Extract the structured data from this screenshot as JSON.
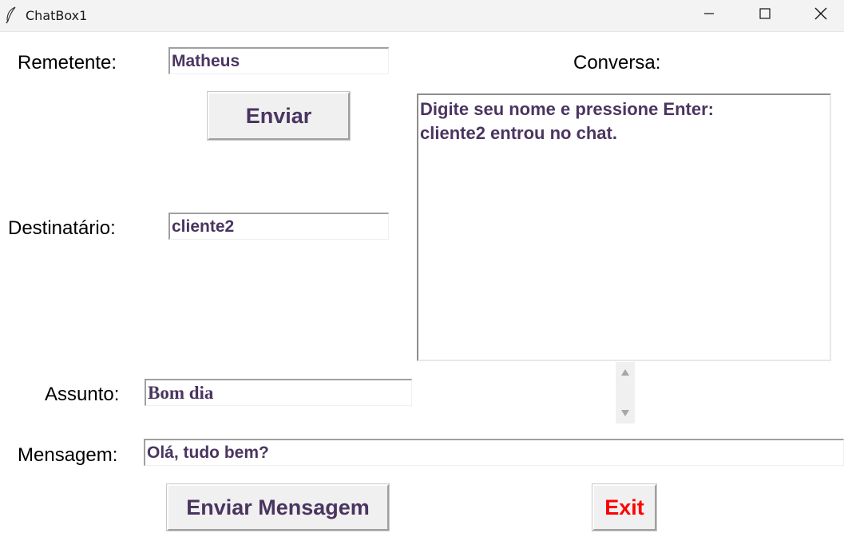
{
  "window": {
    "title": "ChatBox1"
  },
  "form": {
    "remetente_label": "Remetente:",
    "remetente_value": "Matheus",
    "enviar_label": "Enviar",
    "destinatario_label": "Destinatário:",
    "destinatario_value": "cliente2",
    "assunto_label": "Assunto:",
    "assunto_value": "Bom dia",
    "mensagem_label": "Mensagem:",
    "mensagem_value": "Olá, tudo bem?",
    "enviar_mensagem_label": "Enviar Mensagem",
    "exit_label": "Exit"
  },
  "conversa": {
    "label": "Conversa:",
    "lines": [
      "Digite seu nome e pressione Enter:",
      "cliente2 entrou no chat."
    ]
  },
  "colors": {
    "entry_text": "#4a3560",
    "exit_text": "#ff0000",
    "button_face": "#f0f0f0"
  }
}
